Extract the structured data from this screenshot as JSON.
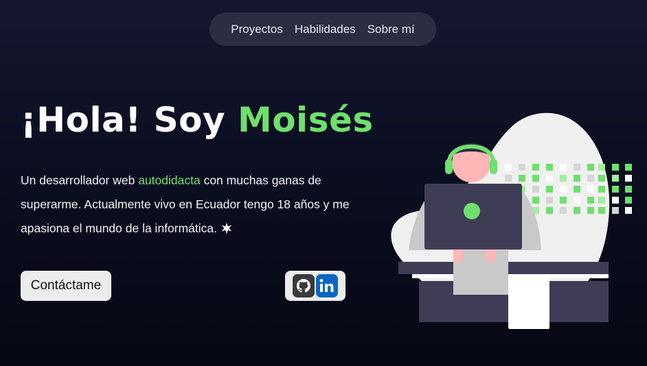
{
  "nav": {
    "items": [
      {
        "label": "Proyectos"
      },
      {
        "label": "Habilidades"
      },
      {
        "label": "Sobre mí"
      }
    ]
  },
  "hero": {
    "title_prefix": "¡Hola! Soy ",
    "title_name": "Moisés",
    "intro_before": "Un desarrollador web ",
    "intro_highlight": "autodidacta",
    "intro_after": " con muchas ganas de superarme. Actualmente vivo en Ecuador tengo 18 años y me apasiona el mundo de la informática.",
    "contact_label": "Contáctame"
  },
  "socials": {
    "github_icon": "github-icon",
    "linkedin_icon": "linkedin-icon",
    "linkedin_text": "in"
  },
  "colors": {
    "accent": "#6fe06d",
    "nav_bg": "#2b2d43",
    "button_bg": "#ececec",
    "linkedin": "#0a66c2"
  }
}
